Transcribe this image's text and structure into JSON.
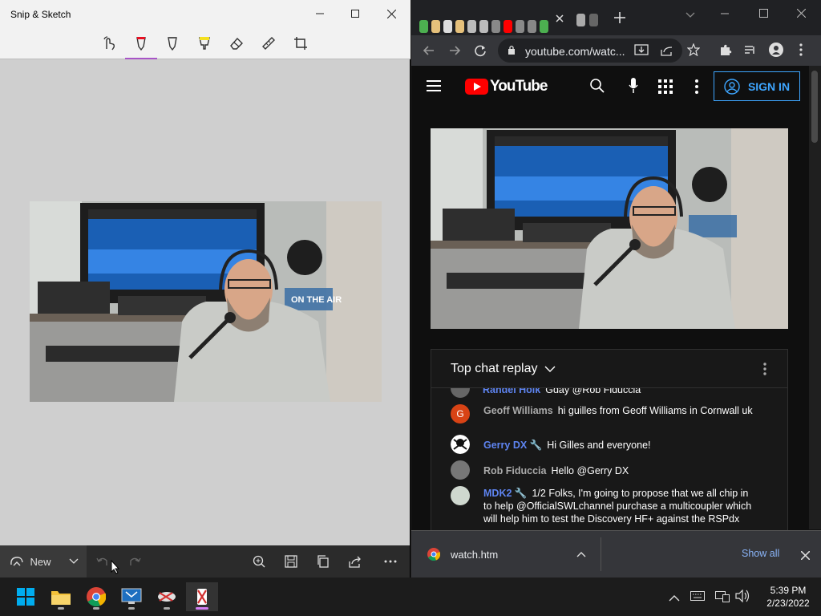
{
  "snip": {
    "title": "Snip & Sketch",
    "new_label": "New"
  },
  "browser": {
    "url": "youtube.com/watc...",
    "yt_logo_text": "YouTube",
    "sign_in": "SIGN IN",
    "chat_header": "Top chat replay",
    "chat_cut_top": "Gday @Rob Fiduccia",
    "chat_cut_author": "Randel Holk",
    "messages": [
      {
        "author": "Geoff Williams",
        "text": "hi guilles from Geoff Williams in Cornwall uk",
        "avatar_letter": "G",
        "avatar_color": "#d84315",
        "author_color": "#aaaaaa"
      },
      {
        "author": "Gerry DX",
        "text": "Hi Gilles and everyone!",
        "avatar_letter": "",
        "avatar_color": "#ffffff",
        "author_color": "#5e84f1",
        "wrench": "🔧"
      },
      {
        "author": "Rob Fiduccia",
        "text": "Hello @Gerry DX",
        "avatar_letter": "",
        "avatar_color": "#777777",
        "author_color": "#aaaaaa"
      },
      {
        "author": "MDK2",
        "text": "1/2 Folks, I'm going to propose that we all chip in to help @OfficialSWLchannel purchase a multicoupler which will help him to test the Discovery HF+ against the RSPdx",
        "avatar_letter": "",
        "avatar_color": "#cfd8cf",
        "author_color": "#5e84f1",
        "wrench": "🔧"
      }
    ],
    "download_file": "watch.htm",
    "show_all": "Show all",
    "video_sign": "ON THE AIR"
  },
  "taskbar": {
    "time": "5:39 PM",
    "date": "2/23/2022"
  },
  "colors": {
    "accent_purple": "#a855c7",
    "yt_red": "#ff0000",
    "signin_blue": "#3ea6ff"
  }
}
